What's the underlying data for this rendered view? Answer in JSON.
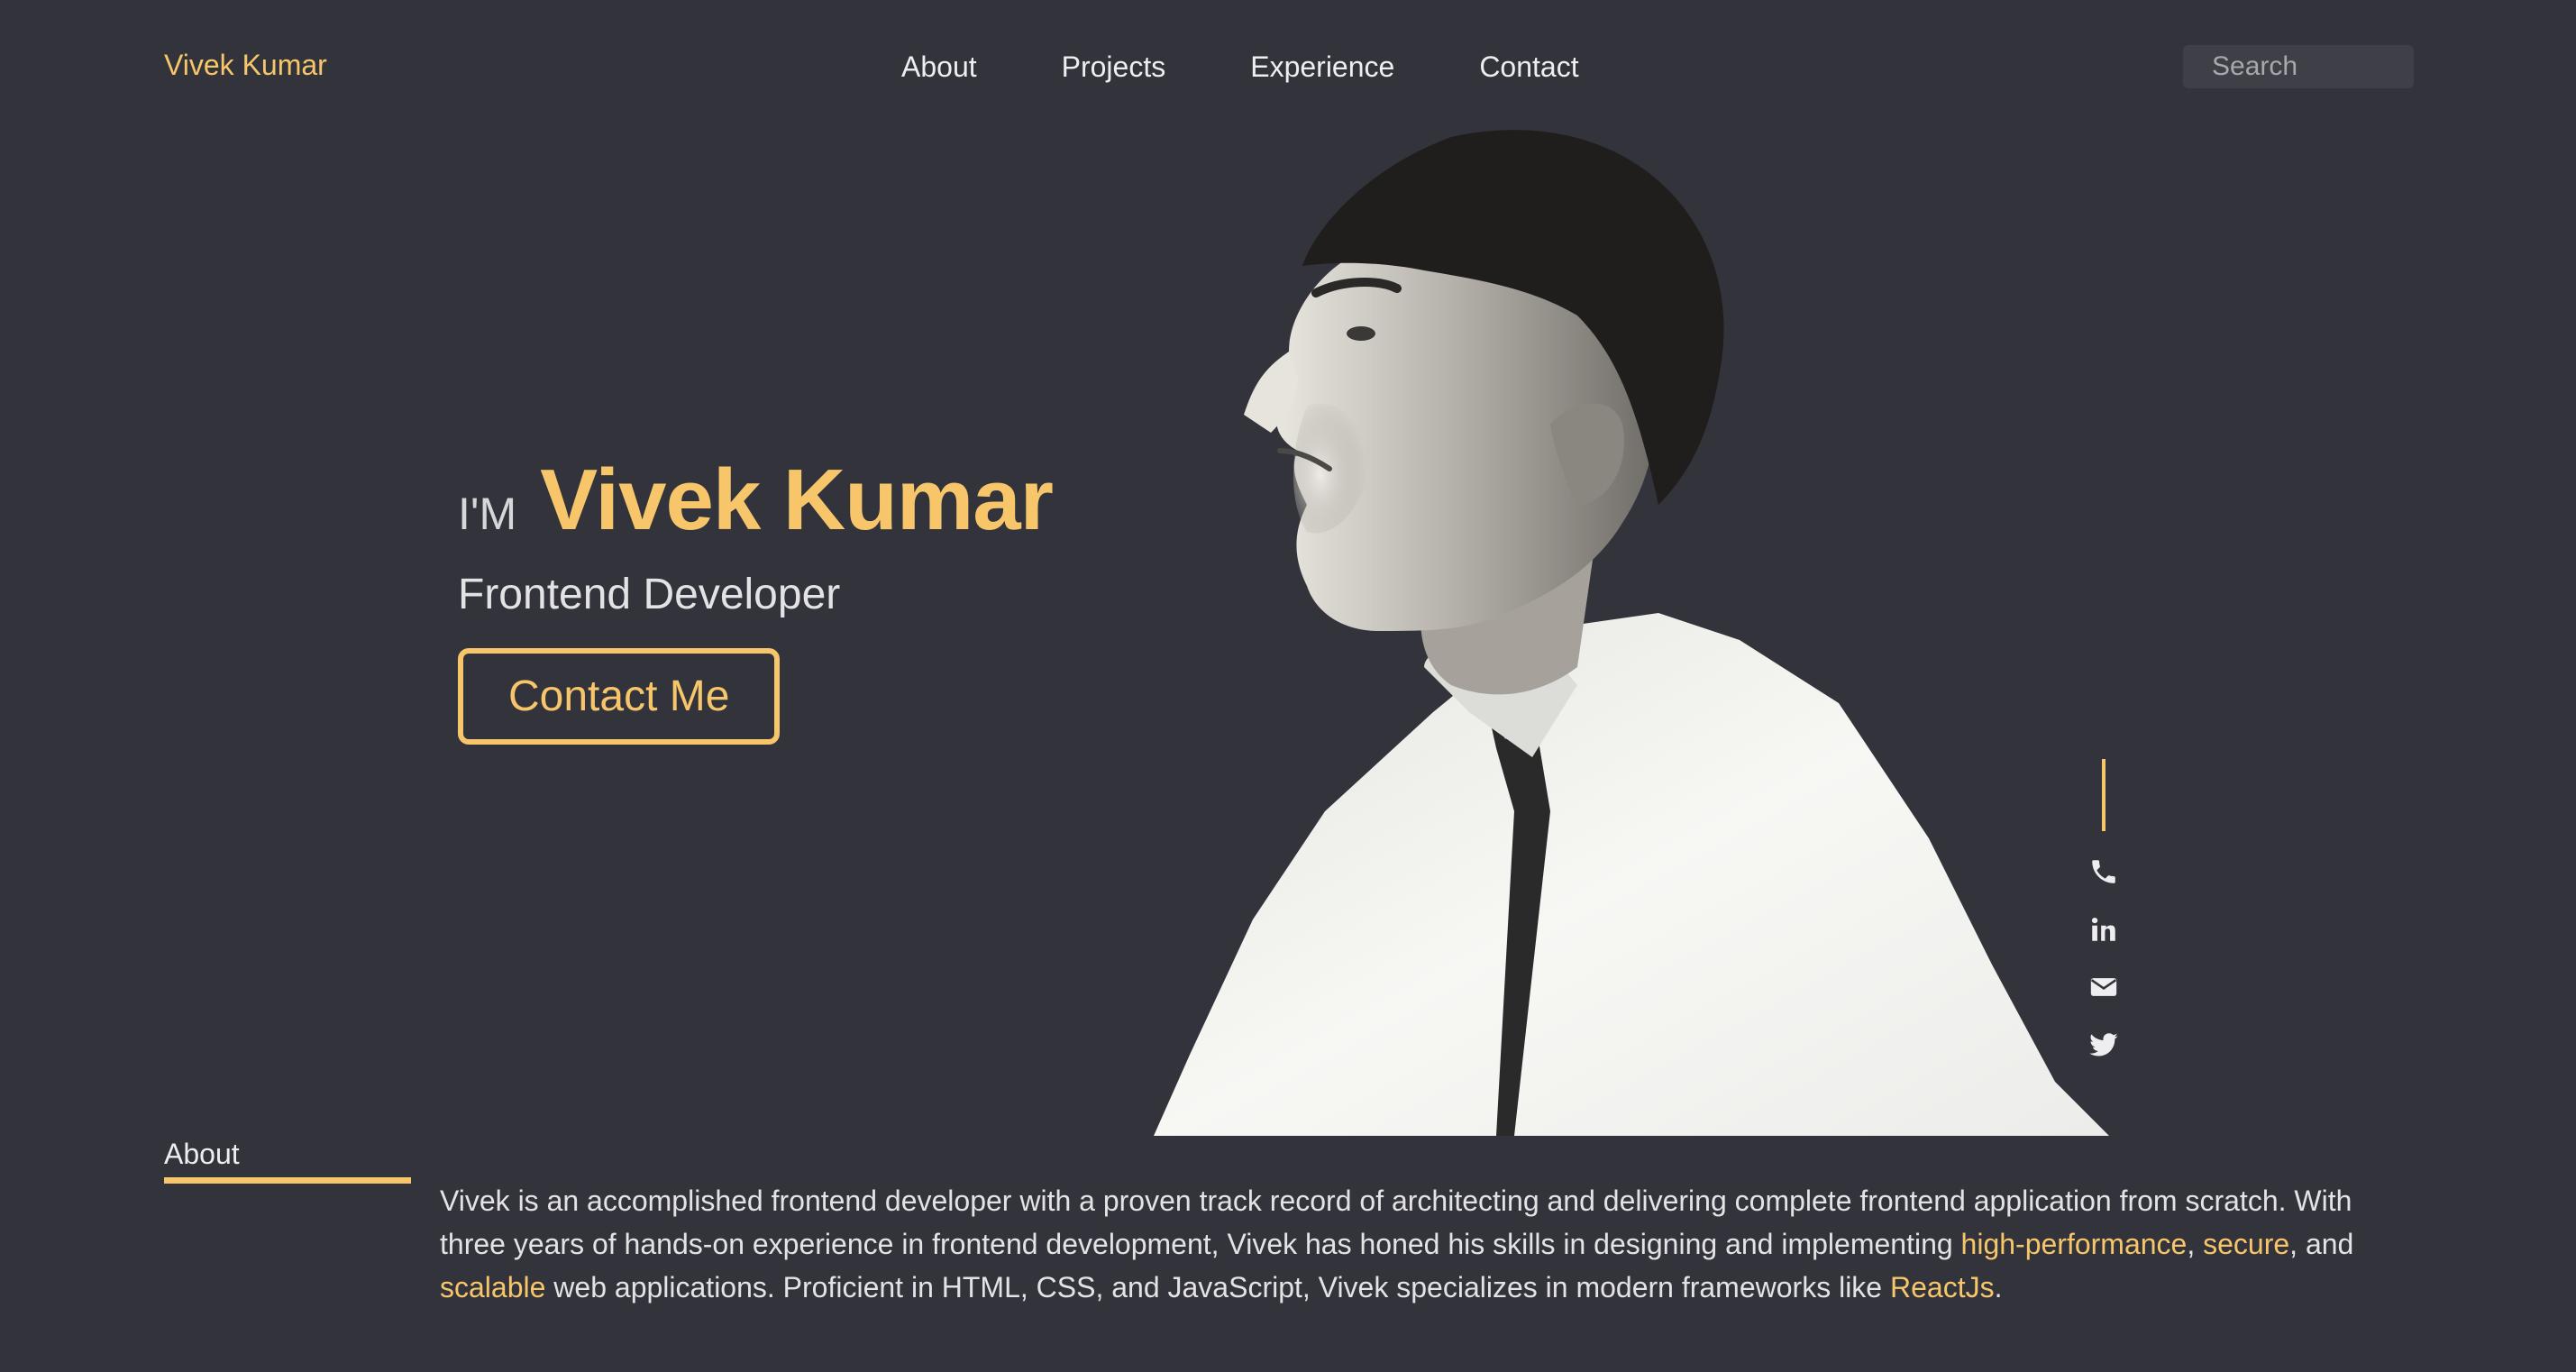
{
  "header": {
    "brand": "Vivek Kumar",
    "nav": [
      {
        "label": "About"
      },
      {
        "label": "Projects"
      },
      {
        "label": "Experience"
      },
      {
        "label": "Contact"
      }
    ],
    "search_placeholder": "Search"
  },
  "hero": {
    "prefix": "I'M",
    "name": "Vivek Kumar",
    "role": "Frontend Developer",
    "cta_label": "Contact Me"
  },
  "social": {
    "icons": [
      "phone-icon",
      "linkedin-icon",
      "envelope-icon",
      "twitter-icon"
    ]
  },
  "about": {
    "heading": "About",
    "text_1": "Vivek is an accomplished frontend developer with a proven track record of architecting and delivering complete frontend application from scratch. With three years of hands-on experience in frontend development, Vivek has honed his skills in designing and implementing ",
    "hl_1": "high-performance",
    "sep_1": ", ",
    "hl_2": "secure",
    "sep_2": ", and ",
    "hl_3": "scalable",
    "text_2": " web applications. Proficient in HTML, CSS, and JavaScript, Vivek specializes in modern frameworks like ",
    "hl_4": "ReactJs",
    "end": "."
  },
  "colors": {
    "background": "#33343b",
    "accent": "#f7c66b",
    "text": "#e9e9ec"
  }
}
